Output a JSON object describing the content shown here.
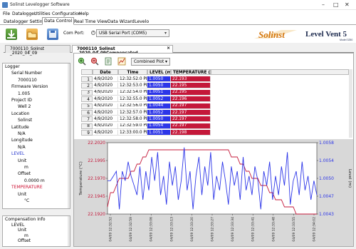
{
  "window": {
    "title": "Solinst Levelogger Software",
    "minimize": "–",
    "maximize": "□",
    "close": "✕"
  },
  "menu": [
    "File",
    "Datalogger",
    "Utilities",
    "Configuration",
    "Help"
  ],
  "tabs": [
    {
      "label": "Datalogger Settings",
      "active": false
    },
    {
      "label": "Data Control",
      "active": true
    },
    {
      "label": "Real Time View",
      "active": false
    },
    {
      "label": "Data Wizard",
      "active": false
    },
    {
      "label": "Levelo",
      "active": false
    }
  ],
  "toolbar": {
    "com_port_label": "Com Port:",
    "com_port_value": "USB Serial Port (COM5)",
    "brand_text": "Solinst",
    "product_text": "Level Vent 5",
    "product_model": "Model 3250"
  },
  "doc_tabs": [
    {
      "label": "7000110_Solinst _2020_04_09",
      "active": false
    },
    {
      "label": "7000110_Solinst _2020_04_09Compensated",
      "active": true,
      "close": "×"
    }
  ],
  "tree": [
    {
      "text": "Logger",
      "level": 0,
      "color": "#000"
    },
    {
      "text": "Serial Number",
      "level": 1,
      "color": "#000"
    },
    {
      "text": "7000110",
      "level": 2,
      "color": "#000"
    },
    {
      "text": "Firmware Version",
      "level": 1,
      "color": "#000"
    },
    {
      "text": "1.005",
      "level": 2,
      "color": "#000"
    },
    {
      "text": "Project ID",
      "level": 1,
      "color": "#000"
    },
    {
      "text": "Well 2",
      "level": 2,
      "color": "#000"
    },
    {
      "text": "Location",
      "level": 1,
      "color": "#000"
    },
    {
      "text": "Solinst",
      "level": 2,
      "color": "#000"
    },
    {
      "text": "Latitude",
      "level": 1,
      "color": "#000"
    },
    {
      "text": "N/A",
      "level": 2,
      "color": "#000"
    },
    {
      "text": "Longitude",
      "level": 1,
      "color": "#000"
    },
    {
      "text": "N/A",
      "level": 2,
      "color": "#000"
    },
    {
      "text": "LEVEL",
      "level": 1,
      "color": "#2233cc"
    },
    {
      "text": "Unit",
      "level": 2,
      "color": "#000"
    },
    {
      "text": "m",
      "level": 3,
      "color": "#000"
    },
    {
      "text": "Offset",
      "level": 2,
      "color": "#000"
    },
    {
      "text": "0.0000 m",
      "level": 3,
      "color": "#000"
    },
    {
      "text": "TEMPERATURE",
      "level": 1,
      "color": "#cc1133"
    },
    {
      "text": "Unit",
      "level": 2,
      "color": "#000"
    },
    {
      "text": "°C",
      "level": 3,
      "color": "#000"
    }
  ],
  "compensation": [
    {
      "text": "Compensation Info",
      "level": 0
    },
    {
      "text": "LEVEL",
      "level": 1
    },
    {
      "text": "Unit",
      "level": 2
    },
    {
      "text": "m",
      "level": 3
    },
    {
      "text": "Offset",
      "level": 2
    }
  ],
  "plot_select": "Combined Plot",
  "table": {
    "headers": [
      "Date",
      "Time",
      "LEVEL (m)",
      "TEMPERATURE (°C)"
    ],
    "rows": [
      [
        "1",
        "4/9/2020",
        "12:32:52.0 PM",
        "1.0050",
        "22.193"
      ],
      [
        "2",
        "4/9/2020",
        "12:32:53.0 PM",
        "1.0050",
        "22.195"
      ],
      [
        "3",
        "4/9/2020",
        "12:32:54.0 PM",
        "1.0051",
        "22.195"
      ],
      [
        "4",
        "4/9/2020",
        "12:32:55.0 PM",
        "1.0052",
        "22.196"
      ],
      [
        "5",
        "4/9/2020",
        "12:32:56.0 PM",
        "1.0044",
        "22.197"
      ],
      [
        "6",
        "4/9/2020",
        "12:32:57.0 PM",
        "1.0052",
        "22.197"
      ],
      [
        "7",
        "4/9/2020",
        "12:32:58.0 PM",
        "1.0050",
        "22.197"
      ],
      [
        "8",
        "4/9/2020",
        "12:32:59.0 PM",
        "1.0054",
        "22.197"
      ],
      [
        "9",
        "4/9/2020",
        "12:33:00.0 PM",
        "1.0051",
        "22.198"
      ]
    ]
  },
  "chart_data": {
    "type": "line",
    "ylabel_left": "Temperature (°C)",
    "ylabel_right": "Level (m)",
    "left_ticks": [
      "22.2020",
      "22.1995",
      "22.1970",
      "22.1945",
      "22.1920"
    ],
    "right_ticks": [
      "1.0058",
      "1.0054",
      "1.0050",
      "1.0047",
      "1.0043"
    ],
    "x_ticks": [
      "04/09 12:32:52",
      "04/09 12:32:59",
      "04/09 12:33:06",
      "04/09 12:33:13",
      "04/09 12:33:20",
      "04/09 12:33:27",
      "04/09 12:33:34",
      "04/09 12:33:41",
      "04/09 12:33:48",
      "04/09 12:33:55",
      "04/09 12:34:02"
    ],
    "ylim_left": [
      22.192,
      22.202
    ],
    "ylim_right": [
      1.0043,
      1.0058
    ],
    "series": [
      {
        "name": "TEMPERATURE (°C)",
        "axis": "left",
        "color": "#c4183a",
        "values": [
          22.193,
          22.195,
          22.195,
          22.196,
          22.197,
          22.197,
          22.197,
          22.197,
          22.198,
          22.198,
          22.199,
          22.199,
          22.2,
          22.2,
          22.201,
          22.201,
          22.201,
          22.201,
          22.201,
          22.201,
          22.201,
          22.201,
          22.201,
          22.201,
          22.201,
          22.201,
          22.201,
          22.201,
          22.201,
          22.201,
          22.201,
          22.201,
          22.201,
          22.201,
          22.201,
          22.201,
          22.201,
          22.201,
          22.201,
          22.201,
          22.201,
          22.201,
          22.2,
          22.2,
          22.2,
          22.199,
          22.199,
          22.198,
          22.198,
          22.197,
          22.197,
          22.197,
          22.196,
          22.196,
          22.196,
          22.195,
          22.195,
          22.194,
          22.194,
          22.194,
          22.193,
          22.193,
          22.193,
          22.193,
          22.192,
          22.192,
          22.192,
          22.192,
          22.192,
          22.192,
          22.192,
          22.192
        ]
      },
      {
        "name": "LEVEL (m)",
        "axis": "right",
        "color": "#2d36e8",
        "values": [
          1.005,
          1.005,
          1.0051,
          1.0052,
          1.0044,
          1.0052,
          1.005,
          1.0054,
          1.0051,
          1.0049,
          1.0047,
          1.0053,
          1.0046,
          1.0052,
          1.0048,
          1.0055,
          1.005,
          1.0056,
          1.0047,
          1.0051,
          1.0045,
          1.0054,
          1.0049,
          1.0053,
          1.0046,
          1.005,
          1.0057,
          1.0048,
          1.0052,
          1.0044,
          1.0051,
          1.0055,
          1.0047,
          1.0053,
          1.0049,
          1.0056,
          1.0046,
          1.0051,
          1.0048,
          1.0054,
          1.005,
          1.0045,
          1.0053,
          1.0049,
          1.0052,
          1.0046,
          1.0055,
          1.0048,
          1.0051,
          1.0047,
          1.0053,
          1.005,
          1.0044,
          1.0052,
          1.0049,
          1.0054,
          1.0046,
          1.0051,
          1.0047,
          1.0053,
          1.0049,
          1.0056,
          1.0045,
          1.005,
          1.0052,
          1.0047,
          1.0054,
          1.0048,
          1.0051,
          1.0046,
          1.005,
          1.0047
        ]
      }
    ]
  }
}
